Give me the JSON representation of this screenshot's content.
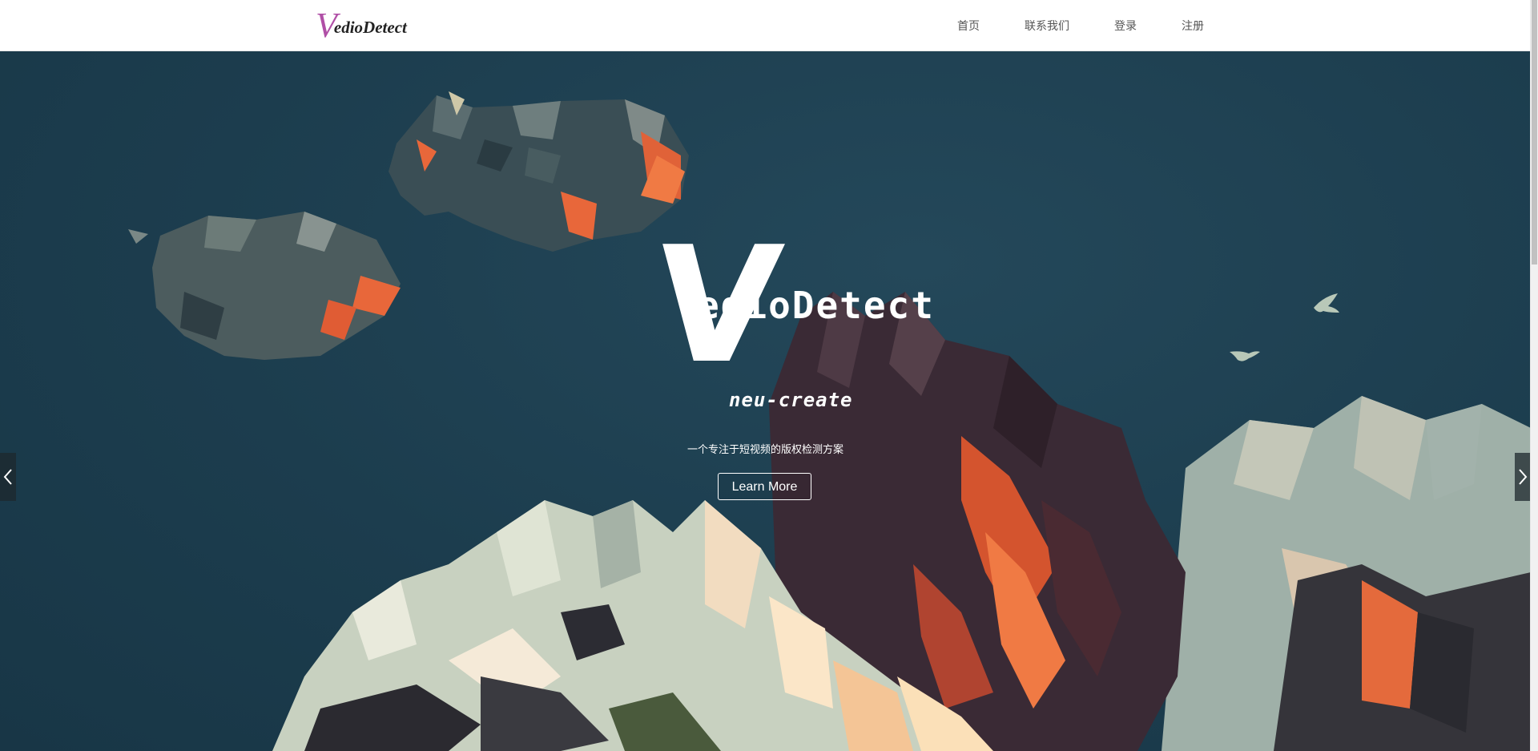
{
  "header": {
    "brand_initial": "V",
    "brand_rest": "edioDetect",
    "nav": [
      {
        "label": "首页"
      },
      {
        "label": "联系我们"
      },
      {
        "label": "登录"
      },
      {
        "label": "注册"
      }
    ]
  },
  "hero": {
    "logo_initial": "V",
    "logo_word1": "edioDetect",
    "logo_word2": "neu-create",
    "tagline": "一个专注于短视频的版权检测方案",
    "cta_label": "Learn More",
    "prev_icon": "chevron-left-icon",
    "next_icon": "chevron-right-icon"
  },
  "colors": {
    "brand_accent": "#b04fa6",
    "hero_bg": "#1c3d4e"
  }
}
